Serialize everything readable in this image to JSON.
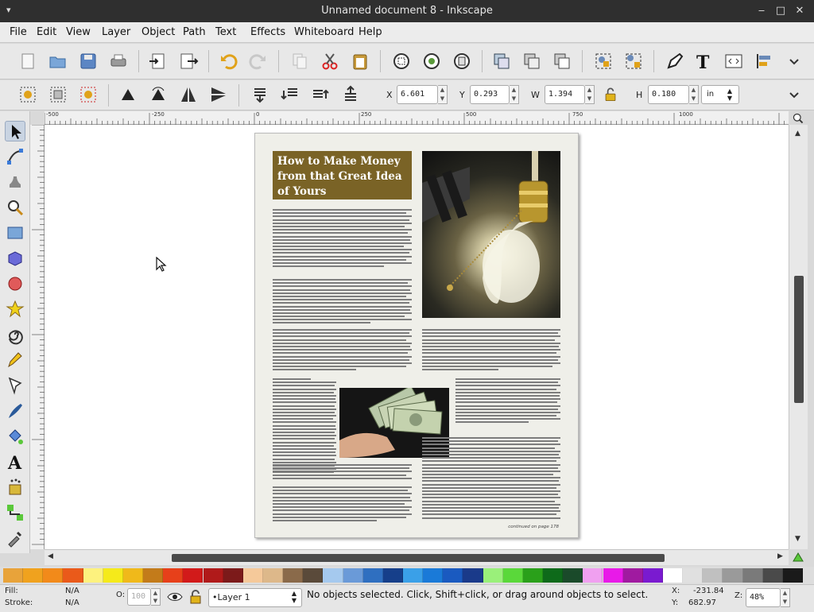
{
  "window": {
    "title": "Unnamed document 8 - Inkscape",
    "min": "‒",
    "max": "□",
    "close": "✕"
  },
  "menu": [
    "File",
    "Edit",
    "View",
    "Layer",
    "Object",
    "Path",
    "Text",
    "Effects",
    "Whiteboard",
    "Help"
  ],
  "controls": {
    "x_label": "X",
    "x_value": "6.601",
    "y_label": "Y",
    "y_value": "0.293",
    "w_label": "W",
    "w_value": "1.394",
    "h_label": "H",
    "h_value": "0.180",
    "unit": "in"
  },
  "ruler_ticks": [
    "-500",
    "-250",
    "0",
    "250",
    "500",
    "750",
    "1000"
  ],
  "document": {
    "headline": "How to Make Money from that Great Idea of Yours",
    "continued": "continued on page 178"
  },
  "palette": [
    "#e8a33a",
    "#f0a21e",
    "#f28a1a",
    "#ea5a1a",
    "#fdf27e",
    "#f5ea1a",
    "#f0b91a",
    "#c37b1a",
    "#e7401a",
    "#d21a1a",
    "#b01a1a",
    "#7c1a1a",
    "#f5c99a",
    "#ddb88a",
    "#8a6a4a",
    "#5a4a3a",
    "#a5c9ee",
    "#6a9ad8",
    "#2f6fc0",
    "#163f8a",
    "#3aa0e8",
    "#1a7ad8",
    "#1a5ac0",
    "#1a3a8a",
    "#9af07a",
    "#5ad83a",
    "#2aa01a",
    "#0e6a1a",
    "#1a4a2a",
    "#f0a0f0",
    "#e81ae8",
    "#a01aa0",
    "#7a1ad0",
    "#ffffff",
    "#e0e0e0",
    "#c0c0c0",
    "#9a9a9a",
    "#7a7a7a",
    "#4a4a4a",
    "#1a1a1a"
  ],
  "status": {
    "fill_label": "Fill:",
    "fill_value": "N/A",
    "stroke_label": "Stroke:",
    "stroke_value": "N/A",
    "opacity_label": "O:",
    "opacity_value": "100",
    "layer": "•Layer 1",
    "message": "No objects selected. Click, Shift+click, or drag around objects to select.",
    "x_label": "X:",
    "x_value": "-231.84",
    "y_label": "Y:",
    "y_value": "682.97",
    "z_label": "Z:",
    "zoom": "48%"
  },
  "colors": {
    "accent": "#7a6326",
    "scroll_thumb": "#4a4a4a"
  }
}
